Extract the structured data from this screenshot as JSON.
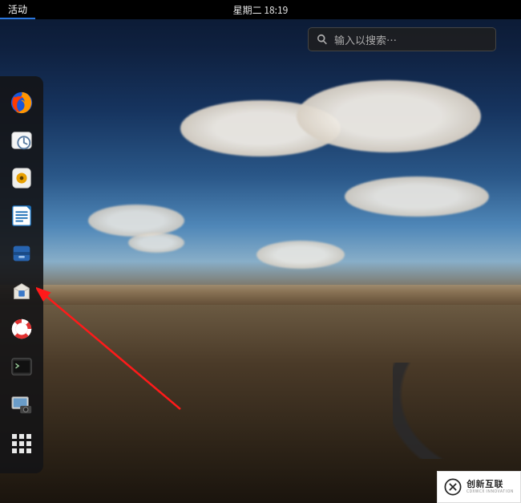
{
  "topbar": {
    "activities_label": "活动",
    "clock": "星期二 18:19"
  },
  "search": {
    "placeholder": "输入以搜索…",
    "icon": "search-icon"
  },
  "dock": {
    "items": [
      {
        "name": "firefox",
        "label": "Firefox"
      },
      {
        "name": "evolution",
        "label": "日历"
      },
      {
        "name": "rhythmbox",
        "label": "音乐"
      },
      {
        "name": "libreoffice-writer",
        "label": "LibreOffice Writer"
      },
      {
        "name": "files",
        "label": "文件"
      },
      {
        "name": "software",
        "label": "软件"
      },
      {
        "name": "help",
        "label": "帮助"
      },
      {
        "name": "terminal",
        "label": "终端"
      },
      {
        "name": "screenshot",
        "label": "截图"
      },
      {
        "name": "apps-grid",
        "label": "显示应用程序"
      }
    ]
  },
  "annotation": {
    "type": "arrow",
    "target": "software"
  },
  "watermark": {
    "brand": "创新互联",
    "sub": "CDXWCX  INNOVATION"
  }
}
